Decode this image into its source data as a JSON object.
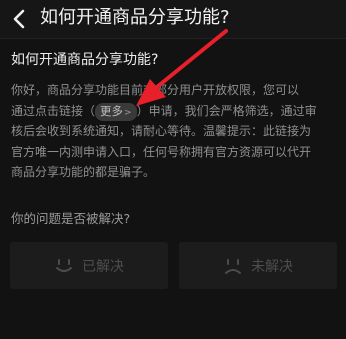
{
  "header": {
    "title": "如何开通商品分享功能?",
    "back_icon": "chevron-left-icon"
  },
  "article": {
    "question": "如何开通商品分享功能?",
    "line1": "你好，商品分享功能目前对部分用户开放权限，您可以",
    "line2_prefix": "通过点击链接（",
    "link_label": "更多",
    "line2_suffix": "）申请，我们会严格筛选，通过审",
    "line3": "核后会收到系统通知，请耐心等待。温馨提示：此链接为",
    "line4": "官方唯一内测申请入口，任何号称拥有官方资源可以代开",
    "line5": "商品分享功能的都是骗子。"
  },
  "feedback": {
    "question": "你的问题是否被解决?",
    "resolved_label": "已解决",
    "unresolved_label": "未解决"
  },
  "colors": {
    "background": "#121212",
    "annotation_arrow": "#e8202a"
  }
}
